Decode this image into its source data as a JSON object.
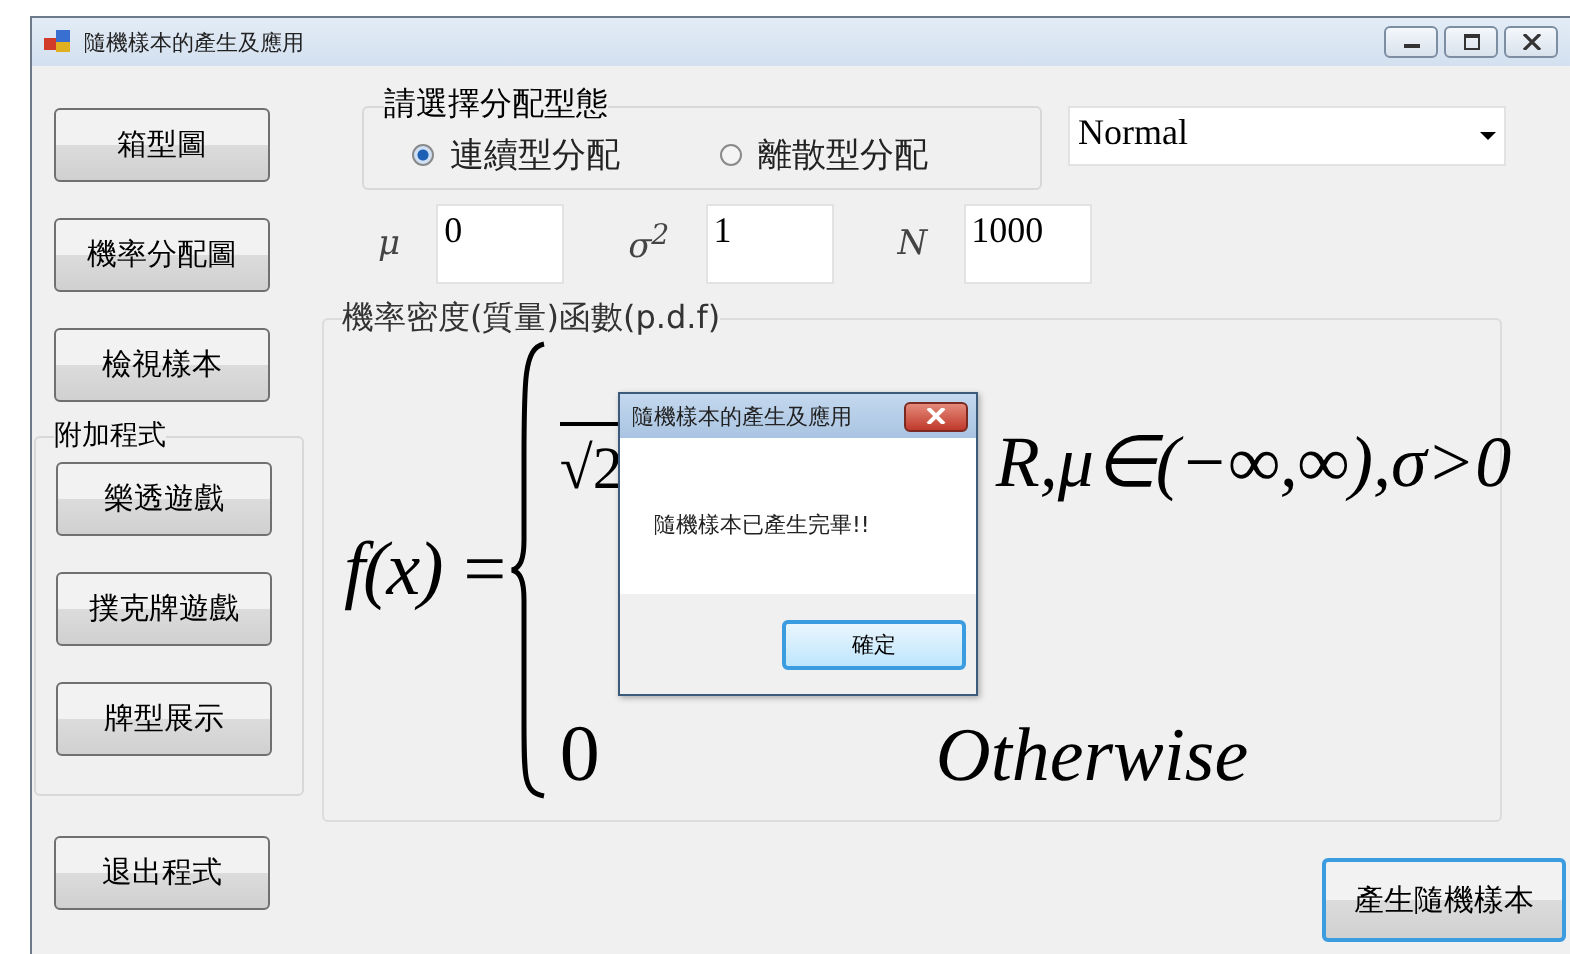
{
  "window": {
    "title": "隨機樣本的產生及應用"
  },
  "left_buttons": [
    {
      "label": "箱型圖"
    },
    {
      "label": "機率分配圖"
    },
    {
      "label": "檢視樣本"
    }
  ],
  "addon_group": {
    "title": "附加程式",
    "buttons": [
      {
        "label": "樂透遊戲"
      },
      {
        "label": "撲克牌遊戲"
      },
      {
        "label": "牌型展示"
      }
    ]
  },
  "exit_button": {
    "label": "退出程式"
  },
  "distribution_group": {
    "title": "請選擇分配型態",
    "options": [
      {
        "label": "連續型分配",
        "selected": true
      },
      {
        "label": "離散型分配",
        "selected": false
      }
    ]
  },
  "distribution_select": {
    "value": "Normal"
  },
  "parameters": [
    {
      "symbol": "μ",
      "value": "0"
    },
    {
      "symbol": "σ$^{2}$",
      "value": "1"
    },
    {
      "symbol": "N",
      "value": "1000"
    }
  ],
  "pdf_group": {
    "title": "機率密度(質量)函數(p.d.f)",
    "formula": {
      "lhs": "f(x) =",
      "case_1_fragment": "√2",
      "case_1_condition": "R,μ∈(−∞,∞),σ>0",
      "case_2_value": "0",
      "case_2_condition": "Otherwise"
    }
  },
  "generate_button": {
    "label": "產生隨機樣本",
    "focused": true
  },
  "dialog": {
    "title": "隨機樣本的產生及應用",
    "message": "隨機樣本已產生完畢!!",
    "ok_button": "確定"
  }
}
